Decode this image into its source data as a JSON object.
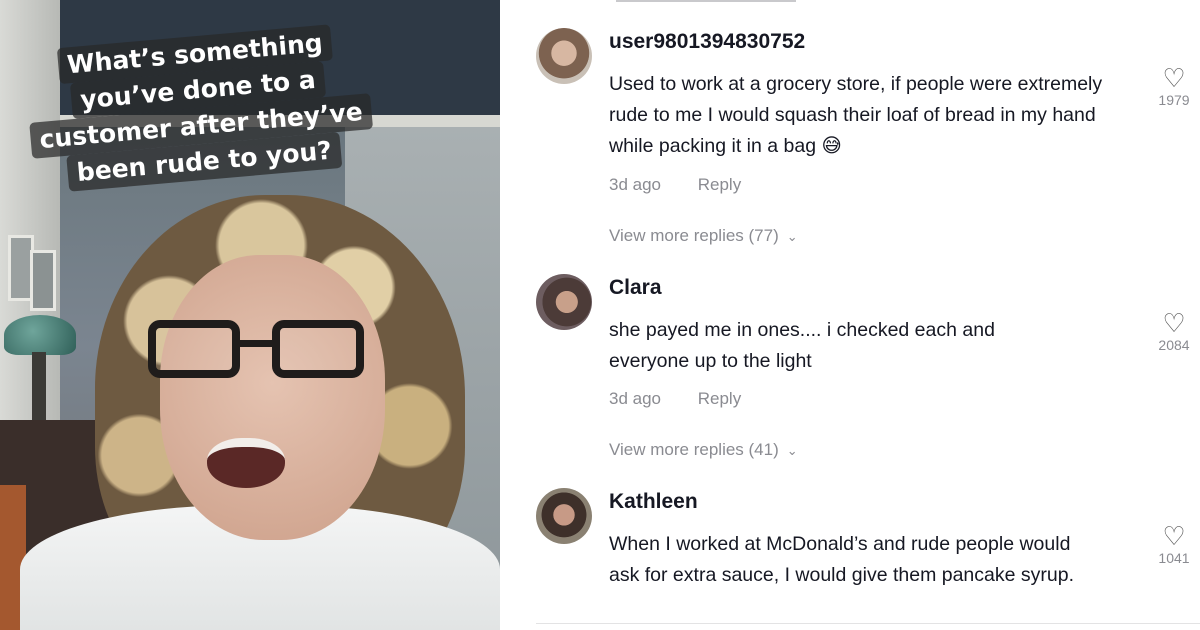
{
  "video": {
    "caption_lines": [
      "What’s something",
      "you’ve done to a",
      "customer after they’ve",
      "been rude to you?"
    ]
  },
  "comments": [
    {
      "username": "user9801394830752",
      "text": "Used to work at a grocery store, if people were extremely rude to me I would squash their loaf of bread in my hand while packing it in a bag 😅",
      "time": "3d ago",
      "reply_label": "Reply",
      "more_replies": "View more replies (77)",
      "likes": "1979"
    },
    {
      "username": "Clara",
      "text": "she payed me in ones.... i checked each and everyone up to the light",
      "time": "3d ago",
      "reply_label": "Reply",
      "more_replies": "View more replies (41)",
      "likes": "2084"
    },
    {
      "username": "Kathleen",
      "text": "When I worked at McDonald’s and rude people would ask for extra sauce, I would give them pancake syrup.",
      "likes": "1041"
    }
  ],
  "icons": {
    "like": "heart-outline-icon",
    "expand": "chevron-down-icon"
  }
}
